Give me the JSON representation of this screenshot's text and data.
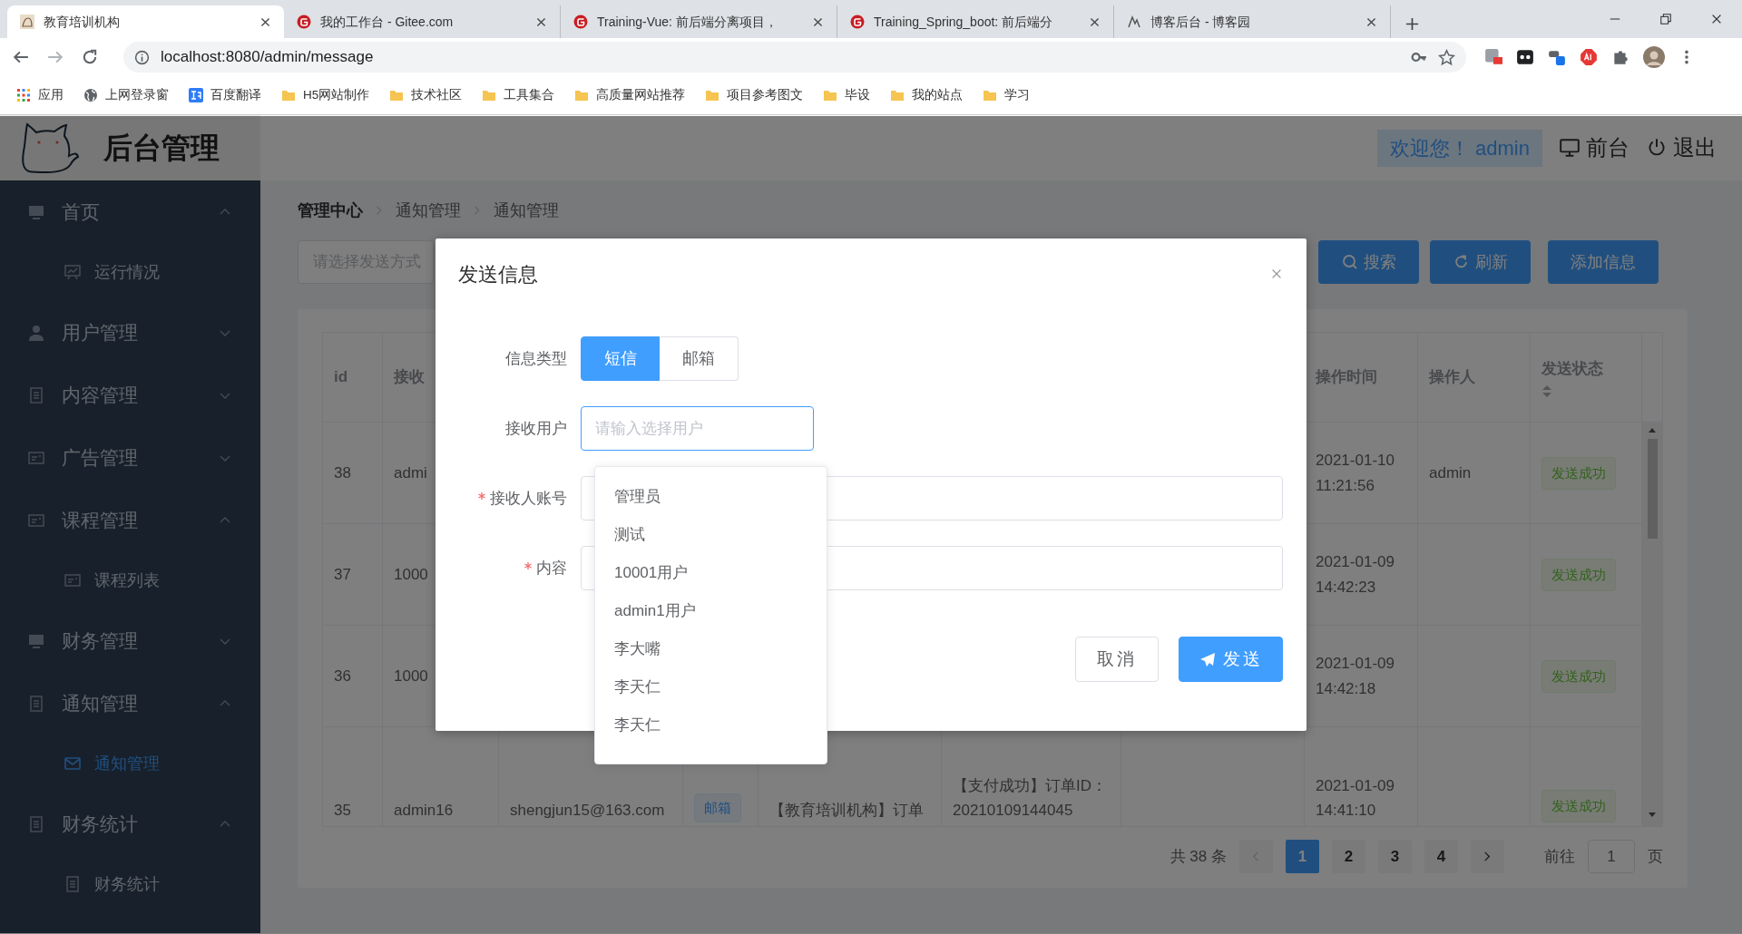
{
  "browser": {
    "tabs": [
      {
        "title": "教育培训机构",
        "selected": true
      },
      {
        "title": "我的工作台 - Gitee.com",
        "selected": false
      },
      {
        "title": "Training-Vue: 前后端分离项目，",
        "selected": false
      },
      {
        "title": "Training_Spring_boot: 前后端分",
        "selected": false
      },
      {
        "title": "博客后台 - 博客园",
        "selected": false
      }
    ],
    "address": "localhost:8080/admin/message",
    "bookmarks": [
      "应用",
      "上网登录窗",
      "百度翻译",
      "H5网站制作",
      "技术社区",
      "工具集合",
      "高质量网站推荐",
      "项目参考图文",
      "毕设",
      "我的站点",
      "学习"
    ]
  },
  "app": {
    "title": "后台管理",
    "welcome": "欢迎您！ admin",
    "header_links": [
      "前台",
      "退出"
    ],
    "sidebar": [
      {
        "label": "首页",
        "expanded": true,
        "children": [
          {
            "label": "运行情况",
            "selected": false
          }
        ]
      },
      {
        "label": "用户管理",
        "expanded": false
      },
      {
        "label": "内容管理",
        "expanded": false
      },
      {
        "label": "广告管理",
        "expanded": false
      },
      {
        "label": "课程管理",
        "expanded": true,
        "children": [
          {
            "label": "课程列表",
            "selected": false
          }
        ]
      },
      {
        "label": "财务管理",
        "expanded": false
      },
      {
        "label": "通知管理",
        "expanded": true,
        "children": [
          {
            "label": "通知管理",
            "selected": true
          }
        ]
      },
      {
        "label": "财务统计",
        "expanded": true,
        "children": [
          {
            "label": "财务统计",
            "selected": false
          }
        ]
      }
    ],
    "breadcrumb": [
      "管理中心",
      "通知管理",
      "通知管理"
    ],
    "filter": {
      "placeholder": "请选择发送方式"
    },
    "toolbar_buttons": [
      "搜索",
      "刷新",
      "添加信息"
    ],
    "table": {
      "columns": [
        {
          "kind": "text",
          "label": "id"
        },
        {
          "kind": "text",
          "label": "接收"
        },
        {
          "kind": "covered"
        },
        {
          "kind": "covered"
        },
        {
          "kind": "covered"
        },
        {
          "kind": "covered"
        },
        {
          "kind": "covered"
        },
        {
          "kind": "text",
          "label": "操作时间"
        },
        {
          "kind": "text",
          "label": "操作人"
        },
        {
          "kind": "sortable",
          "label": "发送状态"
        }
      ],
      "rows": [
        {
          "cells": [
            {
              "kind": "text",
              "text": "38"
            },
            {
              "kind": "text",
              "text": "admi"
            },
            {
              "kind": "covered"
            },
            {
              "kind": "covered"
            },
            {
              "kind": "covered"
            },
            {
              "kind": "covered"
            },
            {
              "kind": "covered"
            },
            {
              "kind": "text",
              "text": "2021-01-10 11:21:56"
            },
            {
              "kind": "text",
              "text": "admin"
            },
            {
              "kind": "status",
              "text": "发送成功"
            }
          ]
        },
        {
          "cells": [
            {
              "kind": "text",
              "text": "37"
            },
            {
              "kind": "text",
              "text": "1000"
            },
            {
              "kind": "covered"
            },
            {
              "kind": "covered"
            },
            {
              "kind": "covered"
            },
            {
              "kind": "covered"
            },
            {
              "kind": "covered"
            },
            {
              "kind": "text",
              "text": "2021-01-09 14:42:23"
            },
            {
              "kind": "empty"
            },
            {
              "kind": "status",
              "text": "发送成功"
            }
          ]
        },
        {
          "cells": [
            {
              "kind": "text",
              "text": "36"
            },
            {
              "kind": "text",
              "text": "1000"
            },
            {
              "kind": "covered"
            },
            {
              "kind": "covered"
            },
            {
              "kind": "covered"
            },
            {
              "kind": "covered"
            },
            {
              "kind": "covered"
            },
            {
              "kind": "text",
              "text": "2021-01-09 14:42:18"
            },
            {
              "kind": "empty"
            },
            {
              "kind": "status",
              "text": "发送成功"
            }
          ]
        },
        {
          "cells": [
            {
              "kind": "text",
              "text": "35"
            },
            {
              "kind": "text",
              "text": "admin16"
            },
            {
              "kind": "text",
              "text": "shengjun15@163.com"
            },
            {
              "kind": "tag",
              "text": "邮箱"
            },
            {
              "kind": "text",
              "text": "【教育培训机构】订单"
            },
            {
              "kind": "text",
              "text": "【支付成功】订单ID：20210109144045"
            },
            {
              "kind": "empty"
            },
            {
              "kind": "text",
              "text": "2021-01-09 14:41:10"
            },
            {
              "kind": "empty"
            },
            {
              "kind": "status",
              "text": "发送成功"
            }
          ]
        }
      ]
    },
    "pagination": {
      "total": "共 38 条",
      "pages": [
        {
          "label": "1",
          "selected": true
        },
        {
          "label": "2",
          "selected": false
        },
        {
          "label": "3",
          "selected": false
        },
        {
          "label": "4",
          "selected": false
        }
      ],
      "goto_label": "前往",
      "goto_value": "1",
      "goto_suffix": "页"
    }
  },
  "dialog": {
    "title": "发送信息",
    "fields": [
      {
        "kind": "segmented",
        "label": "信息类型",
        "required": false,
        "options": [
          {
            "label": "短信",
            "selected": true
          },
          {
            "label": "邮箱",
            "selected": false
          }
        ]
      },
      {
        "kind": "input",
        "label": "接收用户",
        "required": false,
        "placeholder": "请输入选择用户",
        "focused": true
      },
      {
        "kind": "input",
        "label": "接收人账号",
        "required": true,
        "focused": false
      },
      {
        "kind": "input",
        "label": "内容",
        "required": true,
        "focused": false
      }
    ],
    "dropdown": [
      "管理员",
      "测试",
      "10001用户",
      "admin1用户",
      "李大嘴",
      "李天仁",
      "李天仁"
    ],
    "buttons": [
      {
        "kind": "default",
        "label": "取消"
      },
      {
        "kind": "primary",
        "label": "发送"
      }
    ]
  }
}
